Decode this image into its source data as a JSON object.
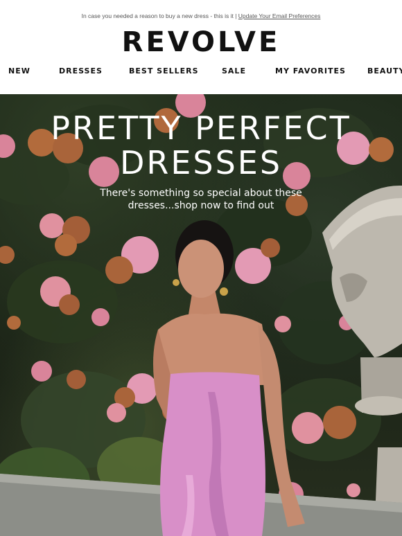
{
  "preheader": {
    "text": "In case you needed a reason to buy a new dress - this is it | ",
    "link": "Update Your Email Preferences"
  },
  "brand": {
    "logo": "REVOLVE"
  },
  "nav": {
    "items": [
      {
        "label": "NEW"
      },
      {
        "label": "DRESSES"
      },
      {
        "label": "BEST SELLERS"
      },
      {
        "label": "SALE"
      },
      {
        "label": "MY FAVORITES"
      },
      {
        "label": "BEAUTY"
      }
    ]
  },
  "hero": {
    "title_line1": "PRETTY PERFECT",
    "title_line2": "DRESSES",
    "subtitle_line1": "There's something so special about these",
    "subtitle_line2": "dresses...shop now to find out"
  },
  "colors": {
    "dress": "#d88fc8",
    "hydrangea": "#d9849a",
    "foliage": "#1f2a1b"
  }
}
